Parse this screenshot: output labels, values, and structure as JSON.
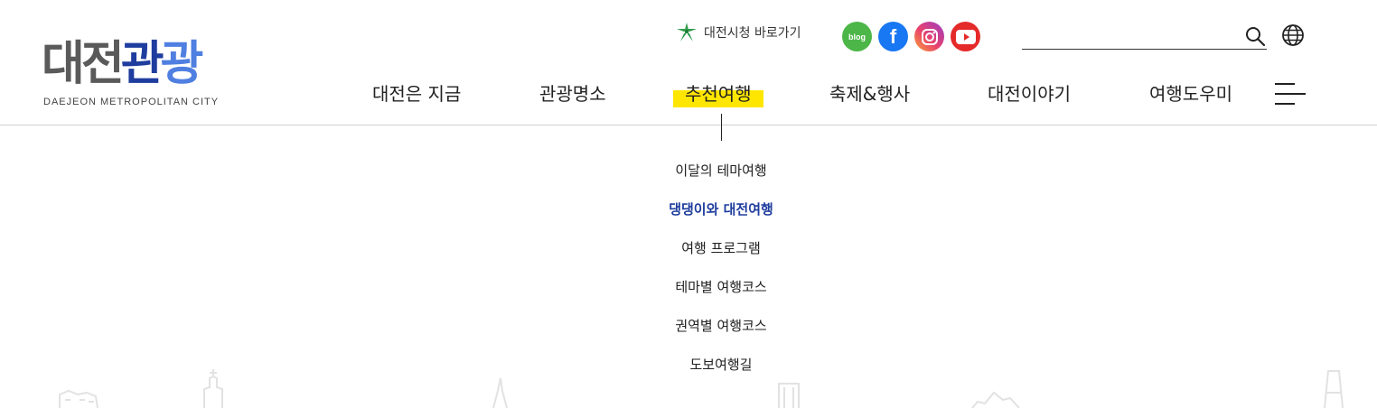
{
  "logo": {
    "gray": "대전",
    "navy": "관",
    "blue": "광",
    "sub": "DAEJEON METROPOLITAN CITY"
  },
  "utility": {
    "cityhall_label": "대전시청 바로가기",
    "sns": [
      {
        "name": "blog",
        "label": "blog",
        "icon": "blog-icon",
        "color": "#4cb648"
      },
      {
        "name": "facebook",
        "label": "f",
        "icon": "facebook-icon",
        "color": "#1877f2"
      },
      {
        "name": "instagram",
        "icon": "instagram-icon",
        "color": "#e9426b"
      },
      {
        "name": "youtube",
        "icon": "youtube-icon",
        "color": "#e52a2a"
      }
    ],
    "search_value": "",
    "search_icon": "search-icon",
    "language_icon": "globe-icon"
  },
  "gnb": {
    "items": [
      {
        "label": "대전은 지금"
      },
      {
        "label": "관광명소"
      },
      {
        "label": "추천여행",
        "active": true
      },
      {
        "label": "축제&행사"
      },
      {
        "label": "대전이야기"
      },
      {
        "label": "여행도우미"
      }
    ],
    "menu_icon": "hamburger-icon",
    "highlight_color": "#ffe600"
  },
  "submenu": {
    "items": [
      {
        "label": "이달의 테마여행"
      },
      {
        "label": "댕댕이와 대전여행",
        "selected": true
      },
      {
        "label": "여행 프로그램"
      },
      {
        "label": "테마별 여행코스"
      },
      {
        "label": "권역별 여행코스"
      },
      {
        "label": "도보여행길"
      }
    ],
    "selected_color": "#1f3d9e"
  }
}
